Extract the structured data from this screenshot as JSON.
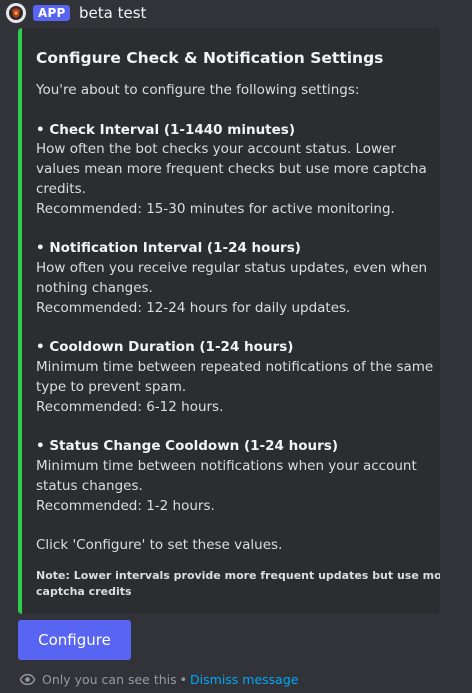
{
  "header": {
    "app_badge": "APP",
    "bot_name": "beta test"
  },
  "embed": {
    "accent_color": "#2ecc4a",
    "title": "Configure Check & Notification Settings",
    "intro": "You're about to configure the following settings:",
    "sections": [
      {
        "heading": "• Check Interval (1-1440 minutes)",
        "lines": [
          "How often the bot checks your account status. Lower",
          "values mean more frequent checks but use more captcha",
          "credits.",
          "Recommended: 15-30 minutes for active monitoring."
        ]
      },
      {
        "heading": "• Notification Interval (1-24 hours)",
        "lines": [
          "How often you receive regular status updates, even when",
          "nothing changes.",
          "Recommended: 12-24 hours for daily updates."
        ]
      },
      {
        "heading": "• Cooldown Duration (1-24 hours)",
        "lines": [
          "Minimum time between repeated notifications of the same",
          "type to prevent spam.",
          "Recommended: 6-12 hours."
        ]
      },
      {
        "heading": "• Status Change Cooldown (1-24 hours)",
        "lines": [
          "Minimum time between notifications when your account",
          "status changes.",
          "Recommended: 1-2 hours."
        ]
      }
    ],
    "outro": "Click 'Configure' to set these values.",
    "footer_lines": [
      "Note: Lower intervals provide more frequent updates but use more",
      "captcha credits"
    ]
  },
  "button": {
    "label": "Configure",
    "color": "#5865f2"
  },
  "ephemeral": {
    "icon": "eye-icon",
    "text": "Only you can see this",
    "separator": "•",
    "dismiss_label": "Dismiss message"
  }
}
